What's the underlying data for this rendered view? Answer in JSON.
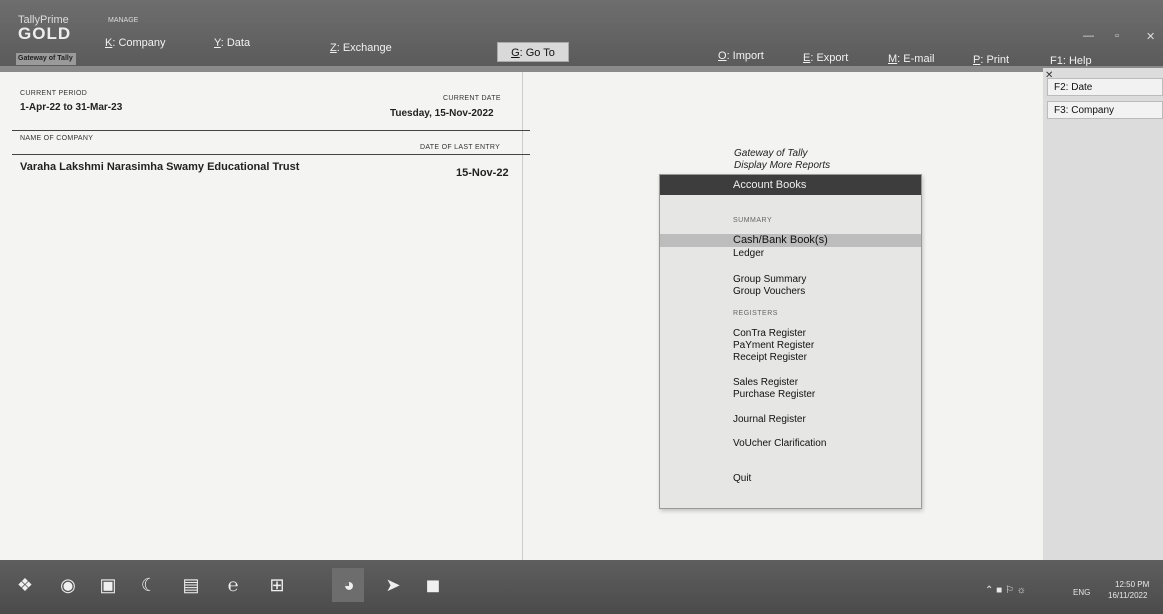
{
  "app": {
    "name": "TallyPrime",
    "edition": "GOLD",
    "screen_tag": "Gateway of Tally"
  },
  "topbar": {
    "manage_label": "MANAGE",
    "menu": {
      "company": {
        "key": "K",
        "label": ": Company"
      },
      "data": {
        "key": "Y",
        "label": ": Data"
      },
      "exchange": {
        "key": "Z",
        "label": ": Exchange"
      },
      "goto": {
        "key": "G",
        "label": ": Go To"
      },
      "import": {
        "key": "O",
        "label": ": Import"
      },
      "export": {
        "key": "E",
        "label": ": Export"
      },
      "email": {
        "key": "M",
        "label": ": E-mail"
      },
      "print": {
        "key": "P",
        "label": ": Print"
      },
      "help": {
        "key": "F1",
        "label": ": Help"
      }
    }
  },
  "left_panel": {
    "current_period_label": "CURRENT PERIOD",
    "current_period_value": "1-Apr-22 to 31-Mar-23",
    "current_date_label": "CURRENT DATE",
    "current_date_value": "Tuesday, 15-Nov-2022",
    "company_col_label": "NAME OF COMPANY",
    "last_entry_col_label": "DATE OF LAST ENTRY",
    "company_name": "Varaha Lakshmi Narasimha Swamy Educational Trust",
    "last_entry_date": "15-Nov-22"
  },
  "report_menu": {
    "breadcrumb_1": "Gateway of Tally",
    "breadcrumb_2": "Display More Reports",
    "title": "Account Books",
    "section_summary": "SUMMARY",
    "section_registers": "REGISTERS",
    "items": {
      "cash_bank": "Cash/Bank Book(s)",
      "ledger": "Ledger",
      "group_summary": "Group Summary",
      "group_vouchers": "Group Vouchers",
      "contra": "ConTra Register",
      "payment": "PaYment Register",
      "receipt": "Receipt Register",
      "sales": "Sales Register",
      "purchase": "Purchase Register",
      "journal": "Journal Register",
      "voucher_clar": "VoUcher Clarification",
      "quit": "Quit"
    }
  },
  "fkeys": {
    "f2": "F2: Date",
    "f3": "F3: Company"
  },
  "tray": {
    "lang": "ENG",
    "time": "12:50 PM",
    "date": "16/11/2022"
  }
}
